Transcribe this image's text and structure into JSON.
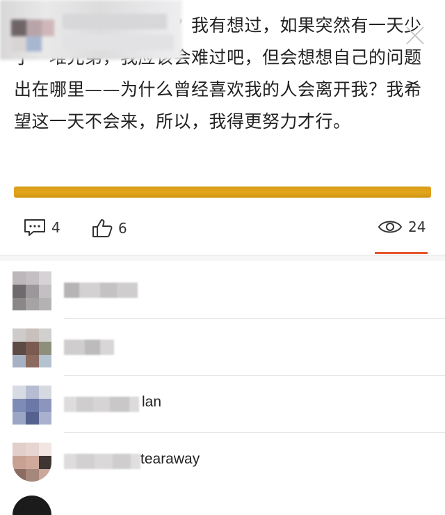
{
  "post": {
    "text": "喜欢我的粉丝离开我？我有想过，如果突然有一天少了一堆兄弟，我应该会难过吧，但会想想自己的问题出在哪里——为什么曾经喜欢我的人会离开我？我希望这一天不会来，所以，我得更努力才行。"
  },
  "actions": {
    "comment_count": "4",
    "like_count": "6",
    "view_count": "24",
    "comment_icon": "comment-icon",
    "like_icon": "thumbs-up-icon",
    "view_icon": "eye-icon"
  },
  "colors": {
    "accent_bar": "#e3a51d",
    "active_underline": "#e5562f"
  },
  "users": [
    {
      "name_visible": ""
    },
    {
      "name_visible": ""
    },
    {
      "name_visible": "lan"
    },
    {
      "name_visible": "tearaway"
    }
  ]
}
